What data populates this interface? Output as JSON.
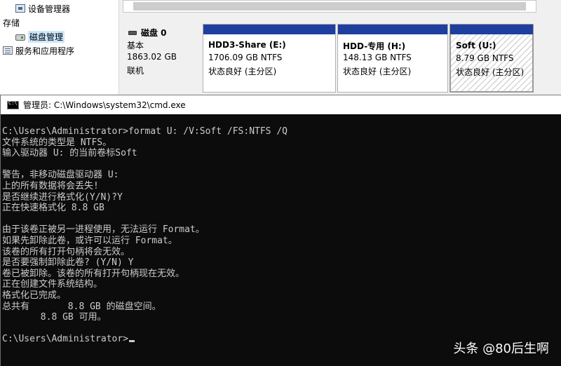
{
  "disk_management": {
    "tree": [
      {
        "label": "设备管理器",
        "icon": "device-manager-icon",
        "selected": false
      },
      {
        "label": "存储",
        "icon": "",
        "selected": false
      },
      {
        "label": "磁盘管理",
        "icon": "disk-management-icon",
        "selected": true
      },
      {
        "label": "服务和应用程序",
        "icon": "services-icon",
        "selected": false
      }
    ],
    "disk": {
      "title": "磁盘 0",
      "type": "基本",
      "size": "1863.02 GB",
      "status": "联机"
    },
    "volumes": [
      {
        "name": "HDD3-Share  (E:)",
        "size": "1706.09 GB NTFS",
        "status": "状态良好 (主分区)"
      },
      {
        "name": "HDD-专用  (H:)",
        "size": "148.13 GB NTFS",
        "status": "状态良好 (主分区)"
      },
      {
        "name": "Soft  (U:)",
        "size": "8.79 GB NTFS",
        "status": "状态良好 (主分区)"
      }
    ],
    "colors": {
      "volume_bar": "#1f3f9f",
      "selected_highlight": "#cce8ff"
    }
  },
  "cmd": {
    "title": "管理员: C:\\Windows\\system32\\cmd.exe",
    "lines": [
      "C:\\Users\\Administrator>format U: /V:Soft /FS:NTFS /Q",
      "文件系统的类型是 NTFS。",
      "输入驱动器 U: 的当前卷标Soft",
      "",
      "警告，非移动磁盘驱动器 U:",
      "上的所有数据将会丢失!",
      "是否继续进行格式化(Y/N)?Y",
      "正在快速格式化 8.8 GB",
      "",
      "由于该卷正被另一进程使用，无法运行 Format。",
      "如果先卸除此卷，或许可以运行 Format。",
      "该卷的所有打开句柄将会无效。",
      "是否要强制卸除此卷? (Y/N) Y",
      "卷已被卸除。该卷的所有打开句柄现在无效。",
      "正在创建文件系统结构。",
      "格式化已完成。",
      "总共有       8.8 GB 的磁盘空间。",
      "       8.8 GB 可用。",
      "",
      "C:\\Users\\Administrator>"
    ],
    "colors": {
      "background": "#0c0c0c",
      "text": "#cccccc"
    }
  },
  "watermark": "头条 @80后生啊"
}
